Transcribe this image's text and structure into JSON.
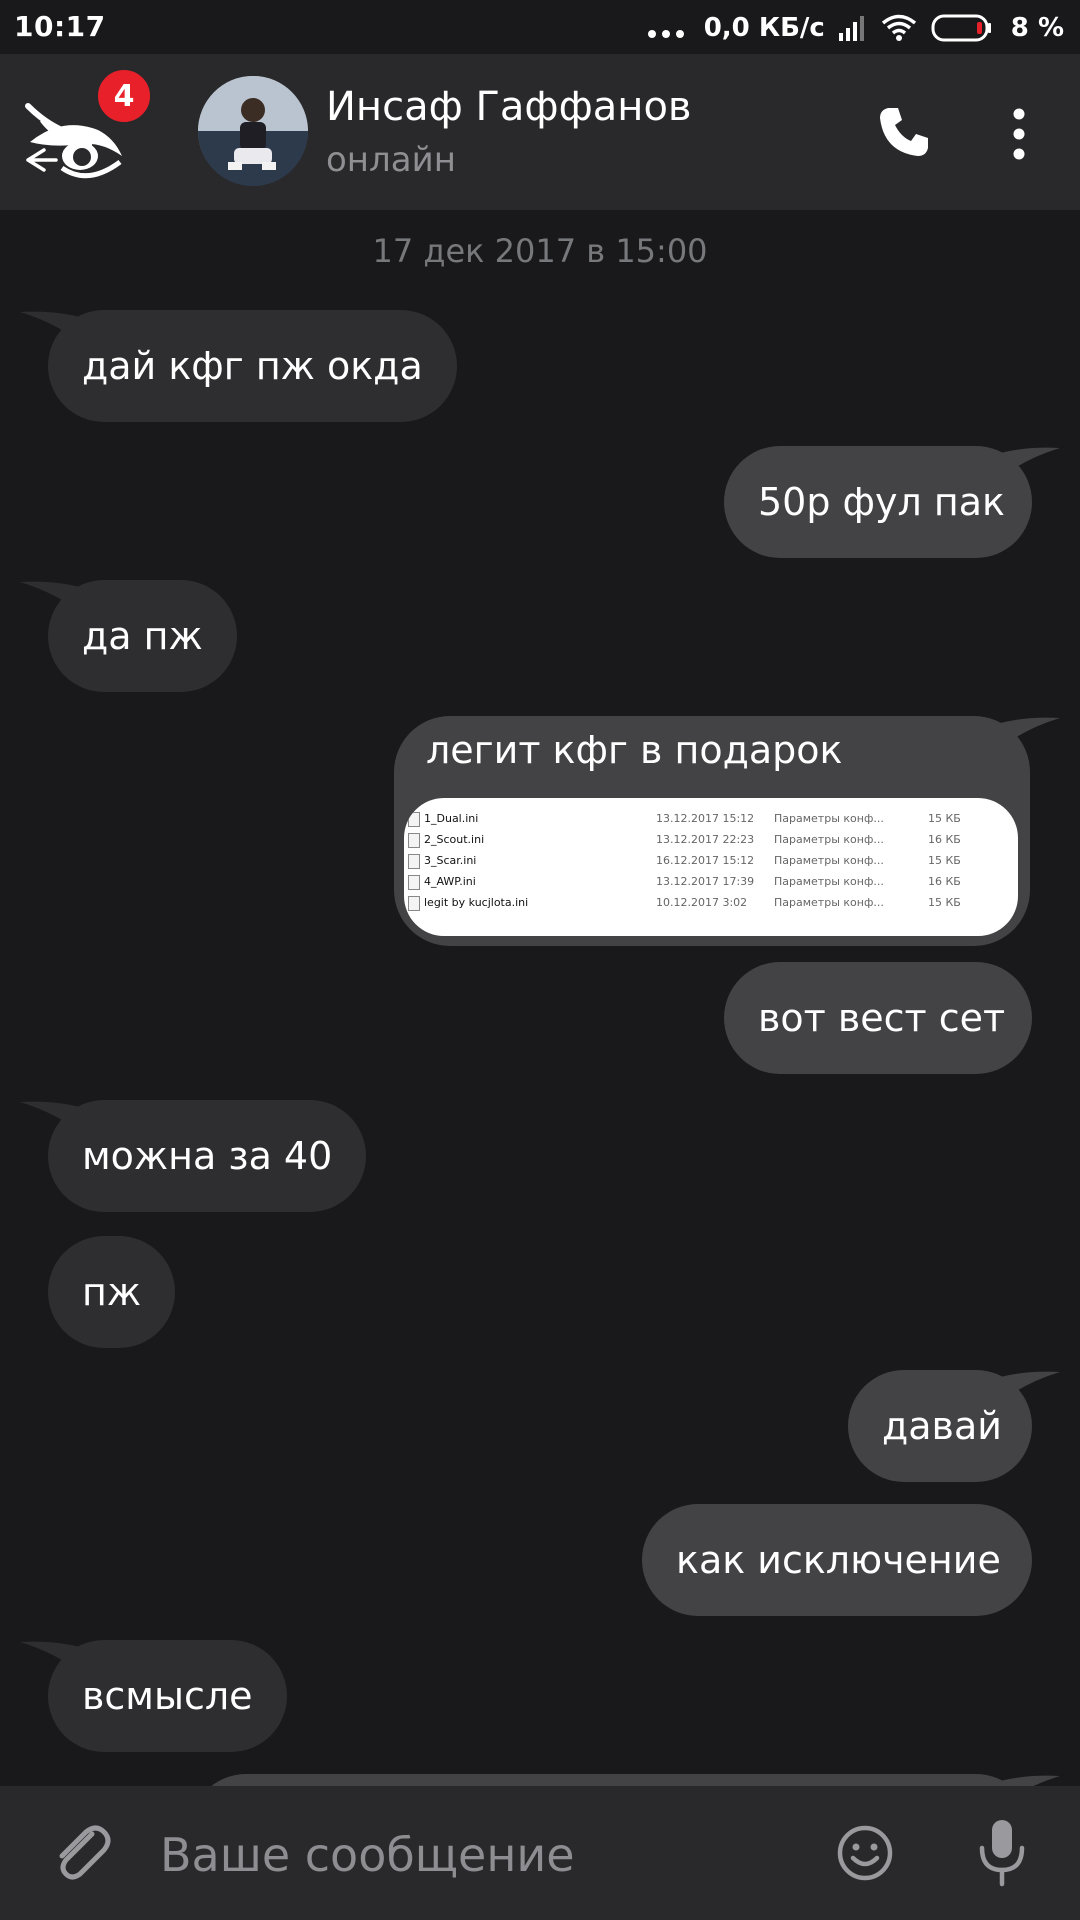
{
  "status_bar": {
    "time": "10:17",
    "net_speed": "0,0 КБ/с",
    "battery": "8 %"
  },
  "header": {
    "unread_badge": "4",
    "contact_name": "Инсаф Гаффанов",
    "contact_status": "онлайн",
    "icons": [
      "back-eye-icon",
      "phone-icon",
      "more-vertical-icon"
    ]
  },
  "chat": {
    "date_separator": "17 дек 2017 в 15:00",
    "messages": [
      {
        "dir": "in",
        "text": "дай кфг пж окда"
      },
      {
        "dir": "out",
        "text": "50р фул пак"
      },
      {
        "dir": "in",
        "text": "да пж"
      },
      {
        "dir": "out",
        "text": "легит кфг в подарок"
      },
      {
        "dir": "out",
        "text": "вот вест сет"
      },
      {
        "dir": "in",
        "text": "можна за 40"
      },
      {
        "dir": "in",
        "text": "пж"
      },
      {
        "dir": "out",
        "text": "давай"
      },
      {
        "dir": "out",
        "text": "как исключение"
      },
      {
        "dir": "in",
        "text": "всмысле"
      }
    ],
    "attachment": {
      "files": [
        {
          "name": "1_Dual.ini",
          "date": "13.12.2017 15:12",
          "type": "Параметры конф...",
          "size": "15 КБ"
        },
        {
          "name": "2_Scout.ini",
          "date": "13.12.2017 22:23",
          "type": "Параметры конф...",
          "size": "16 КБ"
        },
        {
          "name": "3_Scar.ini",
          "date": "16.12.2017 15:12",
          "type": "Параметры конф...",
          "size": "15 КБ"
        },
        {
          "name": "4_AWP.ini",
          "date": "13.12.2017 17:39",
          "type": "Параметры конф...",
          "size": "16 КБ"
        },
        {
          "name": "legit by kucjlota.ini",
          "date": "10.12.2017 3:02",
          "type": "Параметры конф...",
          "size": "15 КБ"
        }
      ]
    }
  },
  "input_bar": {
    "placeholder": "Ваше сообщение",
    "icons": [
      "paperclip-icon",
      "emoji-icon",
      "microphone-icon"
    ]
  },
  "colors": {
    "background": "#19191b",
    "header": "#29292b",
    "incoming_bubble": "#2e2e30",
    "outgoing_bubble": "#434345",
    "badge": "#e8202a"
  }
}
